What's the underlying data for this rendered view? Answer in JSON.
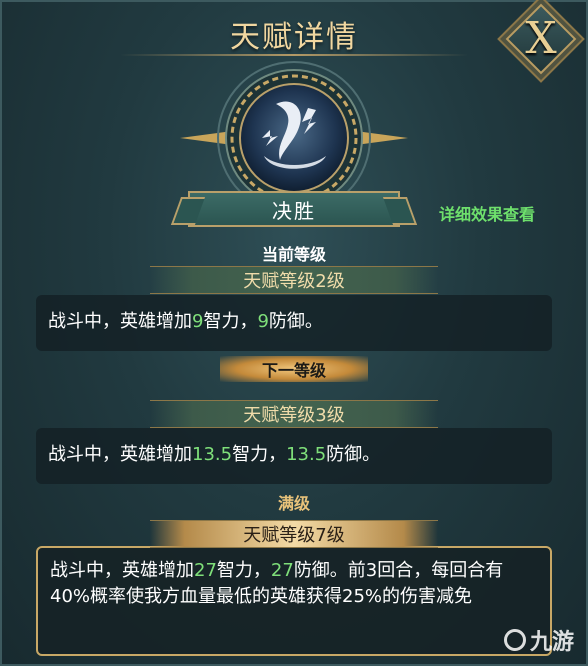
{
  "window": {
    "title": "天赋详情"
  },
  "close": {
    "label": "X"
  },
  "skill": {
    "name": "决胜",
    "icon": "slash-strike-icon"
  },
  "detail_link": "详细效果查看",
  "current": {
    "section_label": "当前等级",
    "level_tag": "天赋等级2级",
    "desc": {
      "pre": "战斗中，英雄增加",
      "v1": "9",
      "mid": "智力，",
      "v2": "9",
      "post": "防御。"
    }
  },
  "next": {
    "section_label": "下一等级",
    "level_tag": "天赋等级3级",
    "desc": {
      "pre": "战斗中，英雄增加",
      "v1": "13.5",
      "mid": "智力，",
      "v2": "13.5",
      "post": "防御。"
    }
  },
  "max": {
    "section_label": "满级",
    "level_tag": "天赋等级7级",
    "desc": {
      "pre": "战斗中，英雄增加",
      "v1": "27",
      "mid": "智力，",
      "v2": "27",
      "post": "防御。前3回合，每回合有40%概率使我方血量最低的英雄获得25%的伤害减免"
    }
  },
  "watermark": "九游",
  "colors": {
    "accent_green": "#7fe07a",
    "title_gold": "#f1d7a0",
    "link_green": "#6ee06c"
  }
}
